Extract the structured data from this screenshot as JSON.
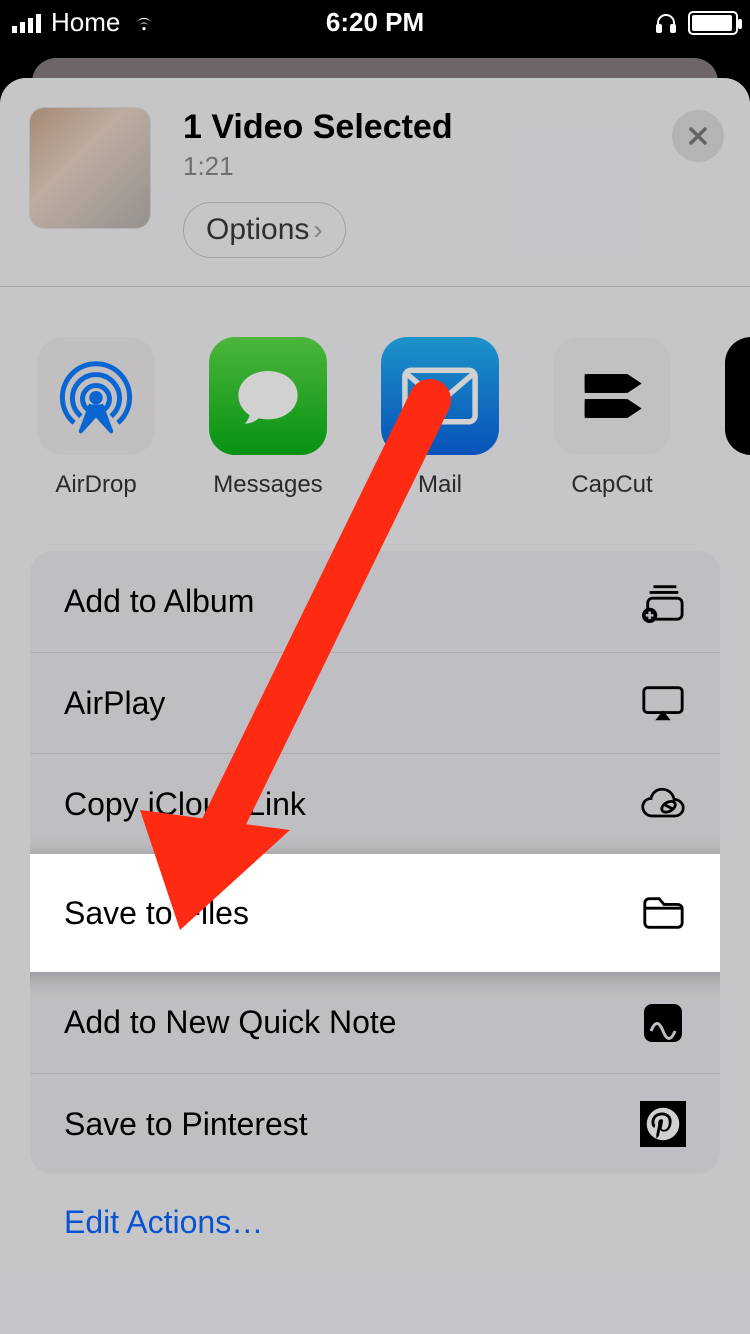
{
  "status": {
    "carrier": "Home",
    "time": "6:20 PM"
  },
  "header": {
    "title": "1 Video Selected",
    "duration": "1:21",
    "options_label": "Options"
  },
  "apps": [
    {
      "label": "AirDrop"
    },
    {
      "label": "Messages"
    },
    {
      "label": "Mail"
    },
    {
      "label": "CapCut"
    }
  ],
  "actions": {
    "add_album": "Add to Album",
    "airplay": "AirPlay",
    "copy_link": "Copy iCloud Link",
    "save_files": "Save to Files",
    "quick_note": "Add to New Quick Note",
    "pinterest": "Save to Pinterest"
  },
  "edit_actions": "Edit Actions…"
}
